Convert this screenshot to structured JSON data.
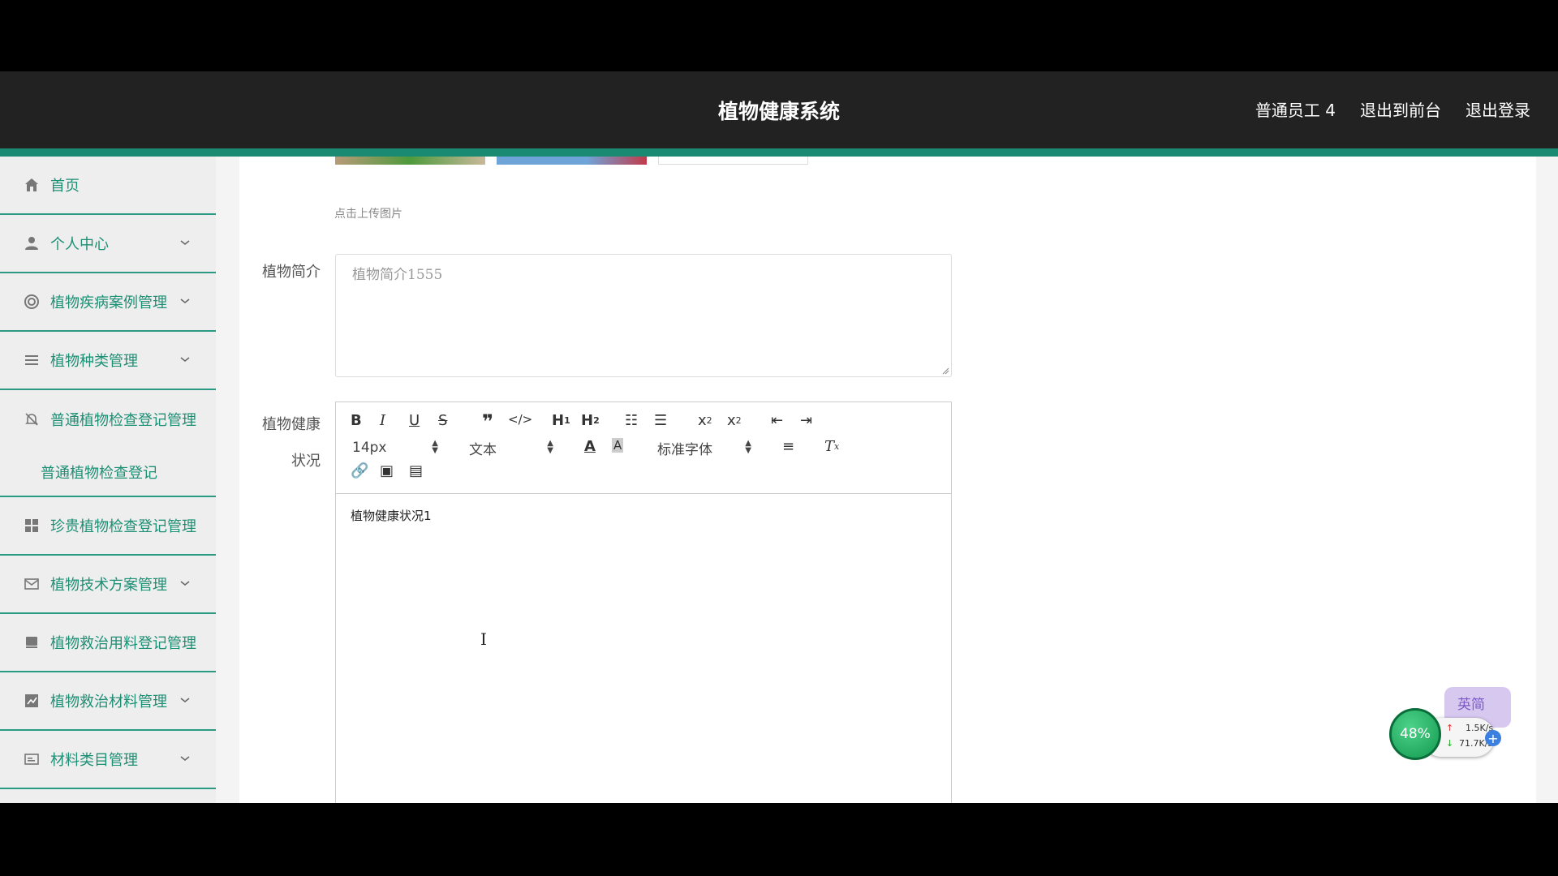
{
  "header": {
    "title": "植物健康系统",
    "user": "普通员工 4",
    "back_to_front": "退出到前台",
    "logout": "退出登录"
  },
  "sidebar": {
    "items": [
      {
        "label": "首页",
        "icon": "home-icon"
      },
      {
        "label": "个人中心",
        "icon": "user-icon"
      },
      {
        "label": "植物疾病案例管理",
        "icon": "lifebuoy-icon"
      },
      {
        "label": "植物种类管理",
        "icon": "list-icon"
      },
      {
        "label": "普通植物检查登记管理",
        "icon": "bell-off-icon"
      },
      {
        "label": "普通植物检查登记",
        "icon": ""
      },
      {
        "label": "珍贵植物检查登记管理",
        "icon": "grid-icon"
      },
      {
        "label": "植物技术方案管理",
        "icon": "mail-icon"
      },
      {
        "label": "植物救治用料登记管理",
        "icon": "book-icon"
      },
      {
        "label": "植物救治材料管理",
        "icon": "chart-icon"
      },
      {
        "label": "材料类目管理",
        "icon": "card-icon"
      }
    ]
  },
  "form": {
    "upload_hint": "点击上传图片",
    "intro_label": "植物简介",
    "intro_value": "植物简介1555",
    "health_label_1": "植物健康",
    "health_label_2": "状况",
    "editor_content": "植物健康状况1"
  },
  "editor": {
    "toolbar": {
      "size": "14px",
      "header": "文本",
      "font": "标准字体",
      "h1": "H1",
      "h2": "H2"
    }
  },
  "widget": {
    "percent": "48%",
    "up": "1.5K/s",
    "down": "71.7K/s",
    "ime": "英简"
  },
  "colors": {
    "accent": "#1a8a73",
    "header_bg": "#222222",
    "nav_text": "#1d8f74"
  }
}
